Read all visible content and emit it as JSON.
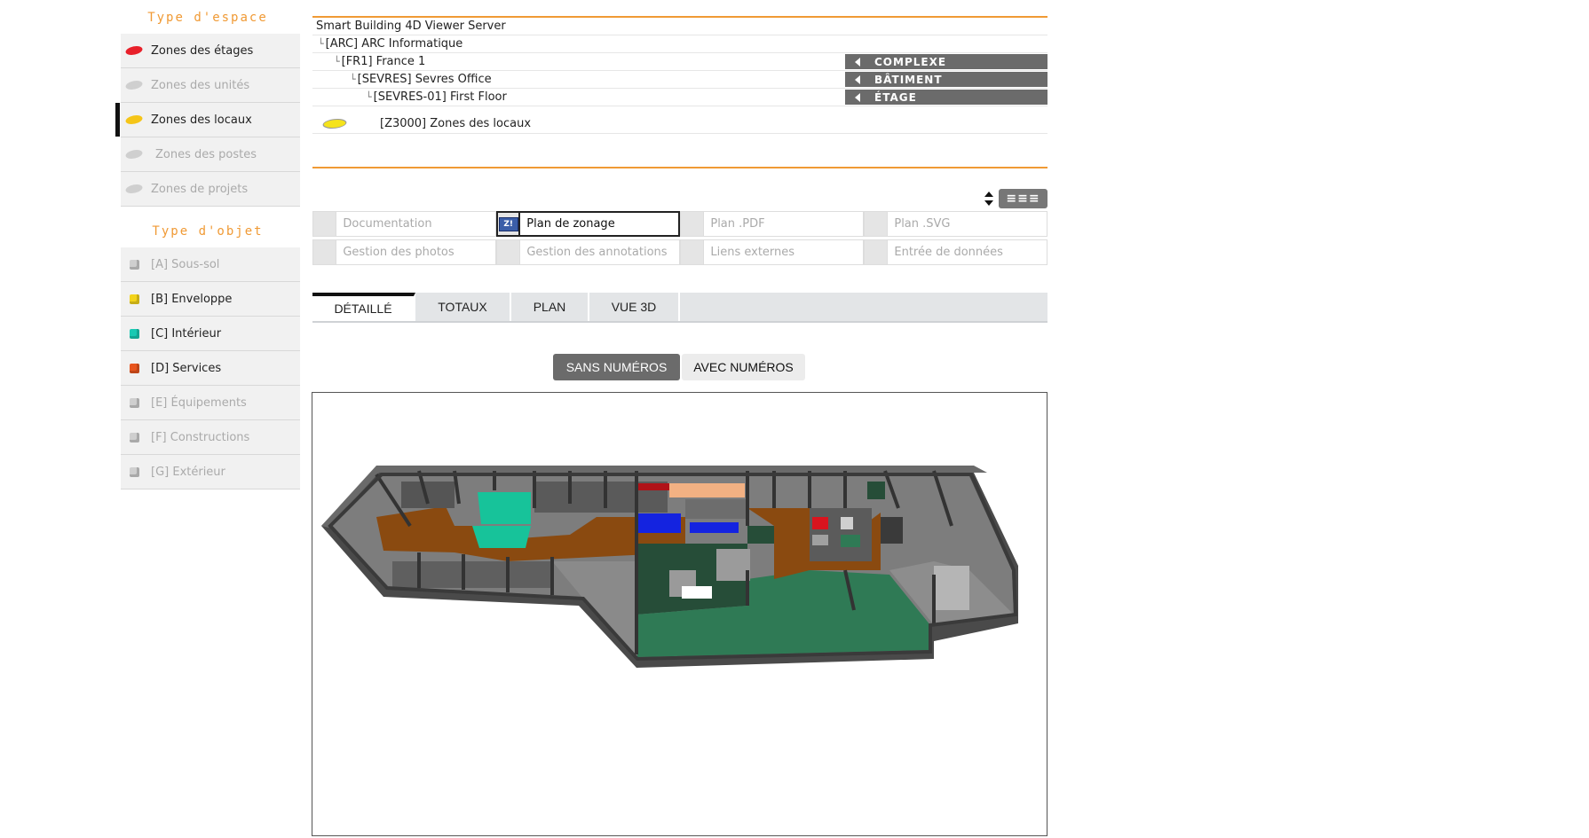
{
  "sidebar": {
    "space_title": "Type d'espace",
    "space_items": [
      {
        "label": "Zones des étages",
        "color": "#e8202a",
        "enabled": true,
        "active": false
      },
      {
        "label": "Zones des unités",
        "color": "#cfcfcf",
        "enabled": false,
        "active": false
      },
      {
        "label": "Zones des locaux",
        "color": "#f5c518",
        "enabled": true,
        "active": true
      },
      {
        "label": "Zones des postes",
        "color": "#cfcfcf",
        "enabled": false,
        "active": false
      },
      {
        "label": "Zones de projets",
        "color": "#cfcfcf",
        "enabled": false,
        "active": false
      }
    ],
    "object_title": "Type d'objet",
    "object_items": [
      {
        "label": "[A] Sous-sol",
        "color": "#cfcfcf",
        "enabled": false
      },
      {
        "label": "[B] Enveloppe",
        "color": "#f3d31a",
        "enabled": true
      },
      {
        "label": "[C] Intérieur",
        "color": "#19c9b3",
        "enabled": true
      },
      {
        "label": "[D] Services",
        "color": "#e8551e",
        "enabled": true
      },
      {
        "label": "[E] Équipements",
        "color": "#cfcfcf",
        "enabled": false
      },
      {
        "label": "[F] Constructions",
        "color": "#cfcfcf",
        "enabled": false
      },
      {
        "label": "[G] Extérieur",
        "color": "#cfcfcf",
        "enabled": false
      }
    ]
  },
  "tree": {
    "root": "Smart Building 4D Viewer Server",
    "org": "[ARC] ARC Informatique",
    "complex": "[FR1] France 1",
    "building": "[SEVRES] Sevres Office",
    "floor": "[SEVRES-01] First Floor",
    "zone": "[Z3000] Zones des locaux",
    "btn_complex": "COMPLEXE",
    "btn_building": "BÂTIMENT",
    "btn_floor": "ÉTAGE"
  },
  "docs": {
    "row1": [
      "Documentation",
      "Plan de zonage",
      "Plan .PDF",
      "Plan .SVG"
    ],
    "row2": [
      "Gestion des photos",
      "Gestion des annotations",
      "Liens externes",
      "Entrée de données"
    ],
    "zoning_icon_text": "Z!"
  },
  "toolbar": {
    "list_view_glyph": "≡≡≡"
  },
  "tabs": [
    "DÉTAILLÉ",
    "TOTAUX",
    "PLAN",
    "VUE 3D"
  ],
  "numbering": {
    "without": "SANS NUMÉROS",
    "with": "AVEC NUMÉROS"
  },
  "colors": {
    "accent": "#f09a35",
    "level_btn": "#6b6b6b",
    "floor_brown": "#8a4a10",
    "floor_green": "#2f7a55",
    "room_teal": "#17c39a",
    "room_blue": "#1423e0",
    "room_red": "#d9141e",
    "room_peach": "#f2b183"
  }
}
